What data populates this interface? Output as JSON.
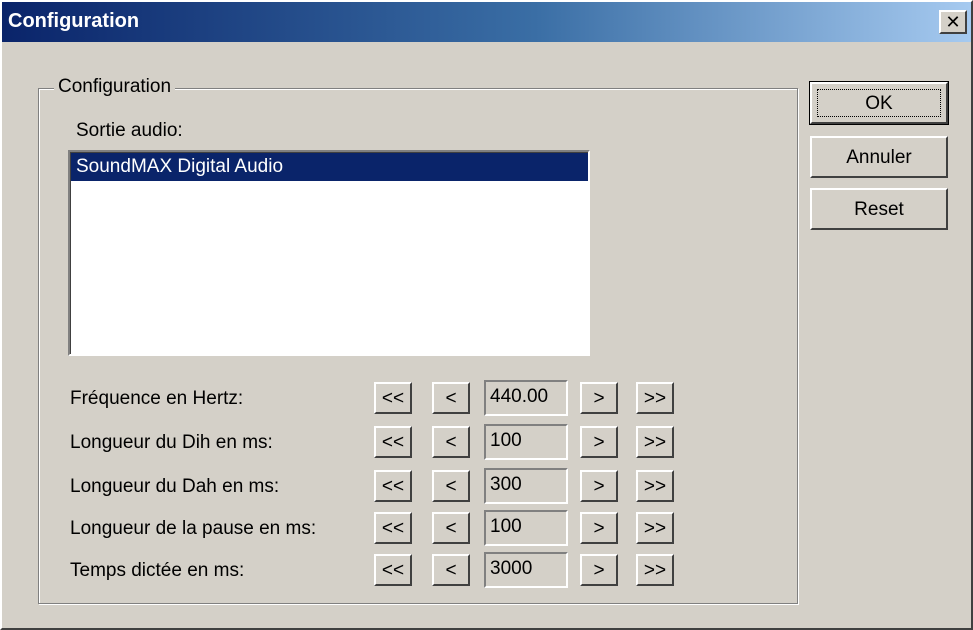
{
  "window": {
    "title": "Configuration",
    "close_glyph": "✕"
  },
  "group": {
    "label": "Configuration",
    "audio_label": "Sortie audio:",
    "audio_devices": [
      {
        "name": "SoundMAX Digital Audio",
        "selected": true
      }
    ]
  },
  "params": [
    {
      "label": "Fréquence en Hertz:",
      "value": "440.00"
    },
    {
      "label": "Longueur du Dih en ms:",
      "value": "100"
    },
    {
      "label": "Longueur du Dah en ms:",
      "value": "300"
    },
    {
      "label": "Longueur de la pause en ms:",
      "value": "100"
    },
    {
      "label": "Temps dictée en ms:",
      "value": "3000"
    }
  ],
  "stepper_labels": {
    "big_down": "<<",
    "down": "<",
    "up": ">",
    "big_up": ">>"
  },
  "buttons": {
    "ok": "OK",
    "cancel": "Annuler",
    "reset": "Reset"
  },
  "colors": {
    "title_gradient_start": "#0a246a",
    "selection": "#0a246a",
    "face": "#d4d0c8"
  }
}
